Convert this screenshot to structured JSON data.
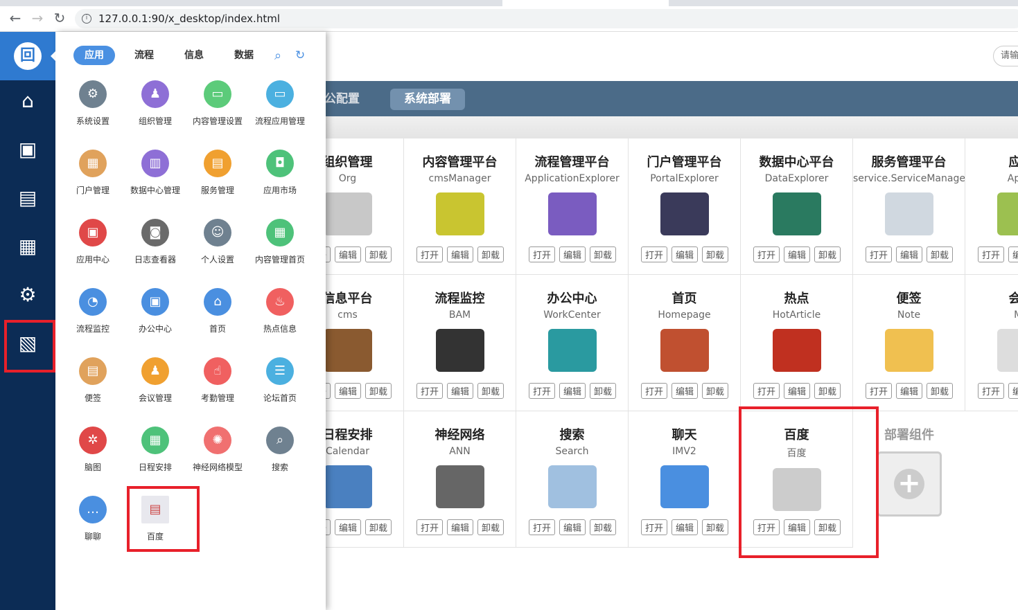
{
  "browser": {
    "url": "127.0.0.1:90/x_desktop/index.html"
  },
  "sidebar": {
    "logo": "回",
    "items": [
      {
        "icon": "home-icon",
        "g": "⌂"
      },
      {
        "icon": "person-screen-icon",
        "g": "▣"
      },
      {
        "icon": "calendar-list-icon",
        "g": "▤"
      },
      {
        "icon": "calendar-icon",
        "g": "▦"
      },
      {
        "icon": "user-settings-icon",
        "g": "⚙"
      },
      {
        "icon": "deploy-window-icon",
        "g": "▧"
      }
    ]
  },
  "panel": {
    "tabs": [
      "应用",
      "流程",
      "信息",
      "数据"
    ],
    "apps": [
      {
        "label": "系统设置",
        "color": "#6f8190",
        "g": "⚙"
      },
      {
        "label": "组织管理",
        "color": "#8e6fd6",
        "g": "♟"
      },
      {
        "label": "内容管理设置",
        "color": "#5ccb7a",
        "g": "▭"
      },
      {
        "label": "流程应用管理",
        "color": "#4bb0e0",
        "g": "▭"
      },
      {
        "label": "门户管理",
        "color": "#e0a25c",
        "g": "▦"
      },
      {
        "label": "数据中心管理",
        "color": "#8e6fd6",
        "g": "▥"
      },
      {
        "label": "服务管理",
        "color": "#f0a030",
        "g": "▤"
      },
      {
        "label": "应用市场",
        "color": "#4ec27a",
        "g": "◘"
      },
      {
        "label": "应用中心",
        "color": "#e04848",
        "g": "▣"
      },
      {
        "label": "日志查看器",
        "color": "#6a6a6a",
        "g": "◙"
      },
      {
        "label": "个人设置",
        "color": "#6f8190",
        "g": "☺"
      },
      {
        "label": "内容管理首页",
        "color": "#4ec27a",
        "g": "▦"
      },
      {
        "label": "流程监控",
        "color": "#4a8fe0",
        "g": "◔"
      },
      {
        "label": "办公中心",
        "color": "#4a8fe0",
        "g": "▣"
      },
      {
        "label": "首页",
        "color": "#4a8fe0",
        "g": "⌂"
      },
      {
        "label": "热点信息",
        "color": "#f06060",
        "g": "♨"
      },
      {
        "label": "便签",
        "color": "#e0a25c",
        "g": "▤"
      },
      {
        "label": "会议管理",
        "color": "#f0a030",
        "g": "♟"
      },
      {
        "label": "考勤管理",
        "color": "#f06060",
        "g": "☝"
      },
      {
        "label": "论坛首页",
        "color": "#4bb0e0",
        "g": "☰"
      },
      {
        "label": "脑图",
        "color": "#e04848",
        "g": "✲"
      },
      {
        "label": "日程安排",
        "color": "#4ec27a",
        "g": "▦"
      },
      {
        "label": "神经网络模型",
        "color": "#f07070",
        "g": "✺"
      },
      {
        "label": "搜索",
        "color": "#6f8190",
        "g": "⌕"
      },
      {
        "label": "聊聊",
        "color": "#4a8fe0",
        "g": "…"
      },
      {
        "label": "百度",
        "color": "#e8e8ee",
        "g": "▤"
      }
    ]
  },
  "header": {
    "search_placeholder": "请输",
    "tabs": [
      "办公配置",
      "系统部署"
    ]
  },
  "buttons": {
    "open": "打开",
    "edit": "编辑",
    "uninstall": "卸载"
  },
  "cards": [
    {
      "title": "组织管理",
      "sub": "Org",
      "color": "#c8c8c8"
    },
    {
      "title": "内容管理平台",
      "sub": "cmsManager",
      "color": "#c9c530"
    },
    {
      "title": "流程管理平台",
      "sub": "ApplicationExplorer",
      "color": "#7a5cc0"
    },
    {
      "title": "门户管理平台",
      "sub": "PortalExplorer",
      "color": "#3a3a5a"
    },
    {
      "title": "数据中心平台",
      "sub": "DataExplorer",
      "color": "#2a7a60"
    },
    {
      "title": "服务管理平台",
      "sub": "service.ServiceManager",
      "color": "#d0d8e0"
    },
    {
      "title": "应用",
      "sub": "AppM",
      "color": "#9cc050"
    },
    {
      "title": "信息平台",
      "sub": "cms",
      "color": "#8a5a30"
    },
    {
      "title": "流程监控",
      "sub": "BAM",
      "color": "#333"
    },
    {
      "title": "办公中心",
      "sub": "WorkCenter",
      "color": "#2a9aa0"
    },
    {
      "title": "首页",
      "sub": "Homepage",
      "color": "#c05030"
    },
    {
      "title": "热点",
      "sub": "HotArticle",
      "color": "#c03020"
    },
    {
      "title": "便签",
      "sub": "Note",
      "color": "#f0c050"
    },
    {
      "title": "会议",
      "sub": "Me",
      "color": "#ddd"
    },
    {
      "title": "日程安排",
      "sub": "Calendar",
      "color": "#4a80c0"
    },
    {
      "title": "神经网络",
      "sub": "ANN",
      "color": "#666"
    },
    {
      "title": "搜索",
      "sub": "Search",
      "color": "#a0c0e0"
    },
    {
      "title": "聊天",
      "sub": "IMV2",
      "color": "#4a8fe0"
    },
    {
      "title": "百度",
      "sub": "百度",
      "color": "#ccc"
    }
  ],
  "deploy": {
    "title": "部署组件"
  }
}
